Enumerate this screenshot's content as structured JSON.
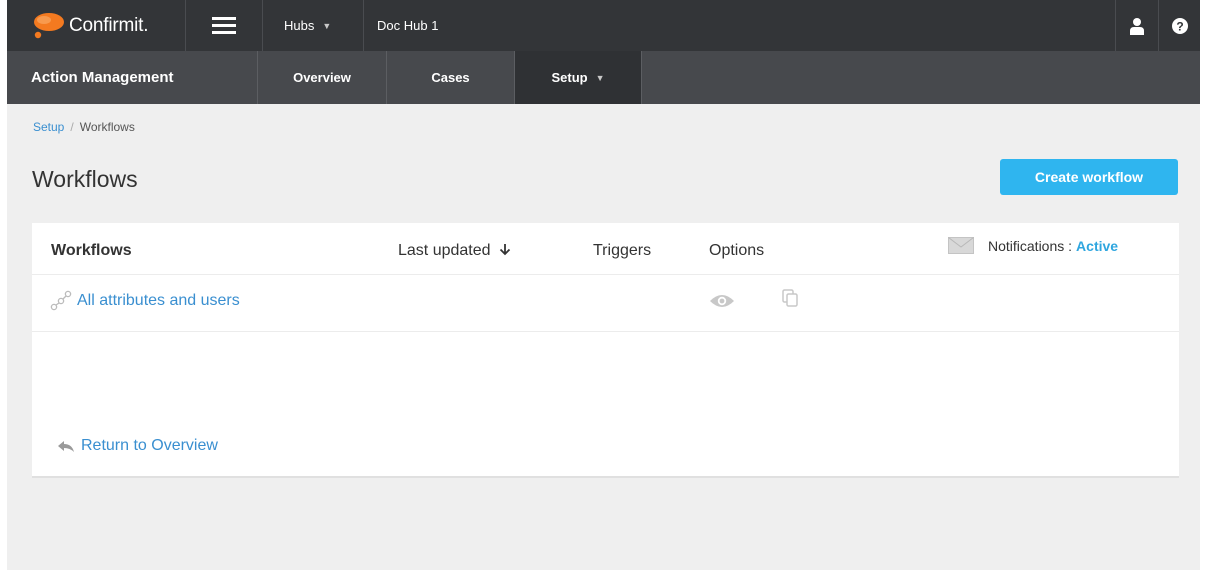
{
  "topbar": {
    "logo_text": "Confirmit.",
    "hubs_label": "Hubs",
    "hub_name": "Doc Hub 1"
  },
  "subnav": {
    "title": "Action Management",
    "tabs": [
      {
        "label": "Overview"
      },
      {
        "label": "Cases"
      },
      {
        "label": "Setup"
      }
    ]
  },
  "breadcrumb": {
    "parent": "Setup",
    "separator": "/",
    "current": "Workflows"
  },
  "page": {
    "title": "Workflows",
    "create_label": "Create workflow"
  },
  "table": {
    "headers": {
      "workflows": "Workflows",
      "last_updated": "Last updated",
      "triggers": "Triggers",
      "options": "Options"
    },
    "notifications": {
      "label": "Notifications :",
      "status": "Active"
    },
    "rows": [
      {
        "name": "All attributes and users"
      }
    ],
    "return_label": "Return to Overview"
  },
  "colors": {
    "topbar": "#333538",
    "subnav": "#47494d",
    "accent": "#2fb5ef",
    "link": "#3a8fd0",
    "logo": "#f47a20"
  },
  "icons": {
    "logo": "confirmit-logo-icon",
    "menu": "hamburger-icon",
    "user": "user-icon",
    "help": "help-icon",
    "sort": "arrow-down-icon",
    "notification": "envelope-icon",
    "workflow": "workflow-nodes-icon",
    "view": "eye-icon",
    "copy": "copy-icon",
    "back": "reply-arrow-icon"
  }
}
